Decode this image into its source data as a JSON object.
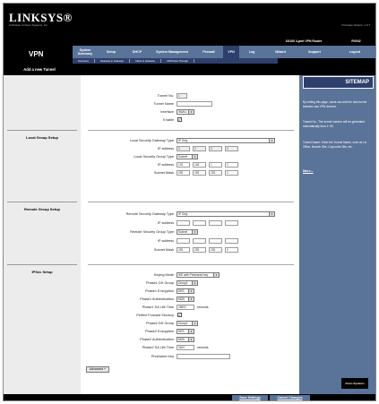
{
  "brand": {
    "logo": "LINKSYS®",
    "sublabel": "A Division of Cisco Systems, Inc.",
    "firmware": "Firmware Version: 1.0.7"
  },
  "header": {
    "section": "VPN",
    "router": "10/100 4-port VPN Router",
    "model": "RV042"
  },
  "nav": [
    {
      "label": "System Summary"
    },
    {
      "label": "Setup"
    },
    {
      "label": "DHCP"
    },
    {
      "label": "System Management"
    },
    {
      "label": "Firewall"
    },
    {
      "label": "VPN"
    },
    {
      "label": "Log"
    },
    {
      "label": "Wizard"
    },
    {
      "label": "Support"
    },
    {
      "label": "Logout"
    }
  ],
  "subnav": [
    "Summary",
    "Gateway to Gateway",
    "Client to Gateway",
    "VPN Pass Through"
  ],
  "page_title": "Add a new Tunnel",
  "sections": {
    "local": "Local Group Setup",
    "remote": "Remote Group Setup",
    "ipsec": "IPSec Setup"
  },
  "tunnel": {
    "no_label": "Tunnel No.",
    "no_value": "1",
    "name_label": "Tunnel Name",
    "name_value": "",
    "interface_label": "Interface",
    "interface_value": "WAN1",
    "enable_label": "Enable",
    "enable_checked": "✓"
  },
  "local": {
    "gw_type_label": "Local Security Gateway Type",
    "gw_type_value": "IP Only",
    "ip_label": "IP address",
    "ip": [
      "0",
      "0",
      "0",
      "0"
    ],
    "group_type_label": "Local Security Group Type",
    "group_type_value": "Subnet",
    "group_ip_label": "IP address",
    "group_ip": [
      "192",
      "168",
      "1",
      "0"
    ],
    "mask_label": "Subnet Mask",
    "mask": [
      "255",
      "255",
      "255",
      "0"
    ]
  },
  "remote": {
    "gw_type_label": "Remote Security Gateway Type",
    "gw_type_value": "IP Only",
    "ip_label": "IP address",
    "ip": [
      "",
      "",
      "",
      ""
    ],
    "group_type_label": "Remote Security Group Type",
    "group_type_value": "Subnet",
    "group_ip_label": "IP address",
    "group_ip": [
      "",
      "",
      "",
      ""
    ],
    "mask_label": "Subnet Mask",
    "mask": [
      "255",
      "255",
      "255",
      "0"
    ]
  },
  "ipsec": {
    "keying_label": "Keying Mode",
    "keying_value": "IKE with Preshared key",
    "p1dh_label": "Phase1 DH Group",
    "p1dh_value": "Group1",
    "p1enc_label": "Phase1 Encryption",
    "p1enc_value": "DES",
    "p1auth_label": "Phase1 Authentication",
    "p1auth_value": "MD5",
    "p1sa_label": "Phase1 SA Life Time",
    "p1sa_value": "28800",
    "p1sa_unit": "seconds",
    "pfs_label": "Perfect Forward Secrecy",
    "pfs_checked": "✓",
    "p2dh_label": "Phase2 DH Group",
    "p2dh_value": "Group1",
    "p2enc_label": "Phase2 Encryption",
    "p2enc_value": "DES",
    "p2auth_label": "Phase2 Authentication",
    "p2auth_value": "MD5",
    "p2sa_label": "Phase2 SA Life Time",
    "p2sa_value": "3600",
    "p2sa_unit": "seconds",
    "psk_label": "Preshared Key",
    "psk_value": "",
    "advanced": "Advanced +"
  },
  "sidebar": {
    "title": "SITEMAP",
    "help": [
      "By setting this page, users can add the new tunnel between two VPN devices.",
      "Tunnel No.: The tunnel number will be generated automatically from 1~50.",
      "Tunnel Name: Enter the Tunnel Name, such as LA Office, Branch Site, Corporate Site, etc."
    ],
    "more": "More..."
  },
  "footer": {
    "save": "Save Settings",
    "cancel": "Cancel Changes",
    "cisco": "Cisco Systems"
  }
}
